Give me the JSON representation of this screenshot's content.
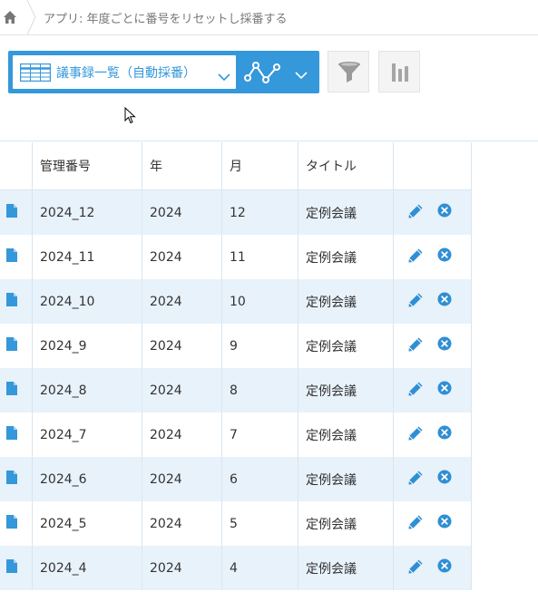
{
  "breadcrumb": {
    "text": "アプリ: 年度ごとに番号をリセットし採番する"
  },
  "toolbar": {
    "view_name": "議事録一覧（自動採番）",
    "accent": "#3498db",
    "icons": [
      "home-icon",
      "list-grid-icon",
      "chevron-down-icon",
      "graph-icon",
      "filter-icon",
      "bar-chart-icon",
      "edit-icon",
      "delete-icon",
      "record-file-icon"
    ]
  },
  "table": {
    "headers": [
      "管理番号",
      "年",
      "月",
      "タイトル"
    ],
    "rows": [
      {
        "id": "2024_12",
        "year": "2024",
        "month": "12",
        "title": "定例会議"
      },
      {
        "id": "2024_11",
        "year": "2024",
        "month": "11",
        "title": "定例会議"
      },
      {
        "id": "2024_10",
        "year": "2024",
        "month": "10",
        "title": "定例会議"
      },
      {
        "id": "2024_9",
        "year": "2024",
        "month": "9",
        "title": "定例会議"
      },
      {
        "id": "2024_8",
        "year": "2024",
        "month": "8",
        "title": "定例会議"
      },
      {
        "id": "2024_7",
        "year": "2024",
        "month": "7",
        "title": "定例会議"
      },
      {
        "id": "2024_6",
        "year": "2024",
        "month": "6",
        "title": "定例会議"
      },
      {
        "id": "2024_5",
        "year": "2024",
        "month": "5",
        "title": "定例会議"
      },
      {
        "id": "2024_4",
        "year": "2024",
        "month": "4",
        "title": "定例会議"
      }
    ]
  }
}
